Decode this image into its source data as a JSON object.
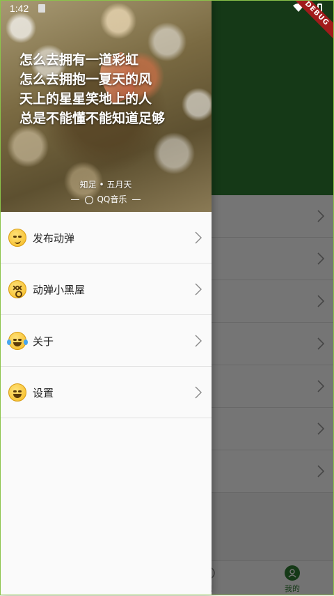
{
  "status_bar": {
    "time": "1:42",
    "debug_label": "DEBUG"
  },
  "drawer": {
    "header": {
      "lyrics": [
        "怎么去拥有一道彩虹",
        "怎么去拥抱一夏天的风",
        "天上的星星笑地上的人",
        "总是不能懂不能知道足够"
      ],
      "song": "知足 • 五月天",
      "source": "QQ音乐"
    },
    "menu": [
      {
        "label": "发布动弹",
        "icon": "smirk-emoji-icon"
      },
      {
        "label": "动弹小黑屋",
        "icon": "dizzy-face-emoji-icon"
      },
      {
        "label": "关于",
        "icon": "tears-of-joy-emoji-icon"
      },
      {
        "label": "设置",
        "icon": "grinning-squint-emoji-icon"
      }
    ]
  },
  "tab_bar": {
    "tabs": [
      {
        "label": "",
        "icon": "tab-icon"
      },
      {
        "label": "",
        "icon": "tab-icon"
      },
      {
        "label": "现",
        "icon": "discover-icon"
      },
      {
        "label": "我的",
        "icon": "user-icon"
      }
    ]
  },
  "colors": {
    "primary": "#2e7d32",
    "scrim": "rgba(0,0,0,0.54)",
    "drawer_bg": "#fafafa"
  }
}
